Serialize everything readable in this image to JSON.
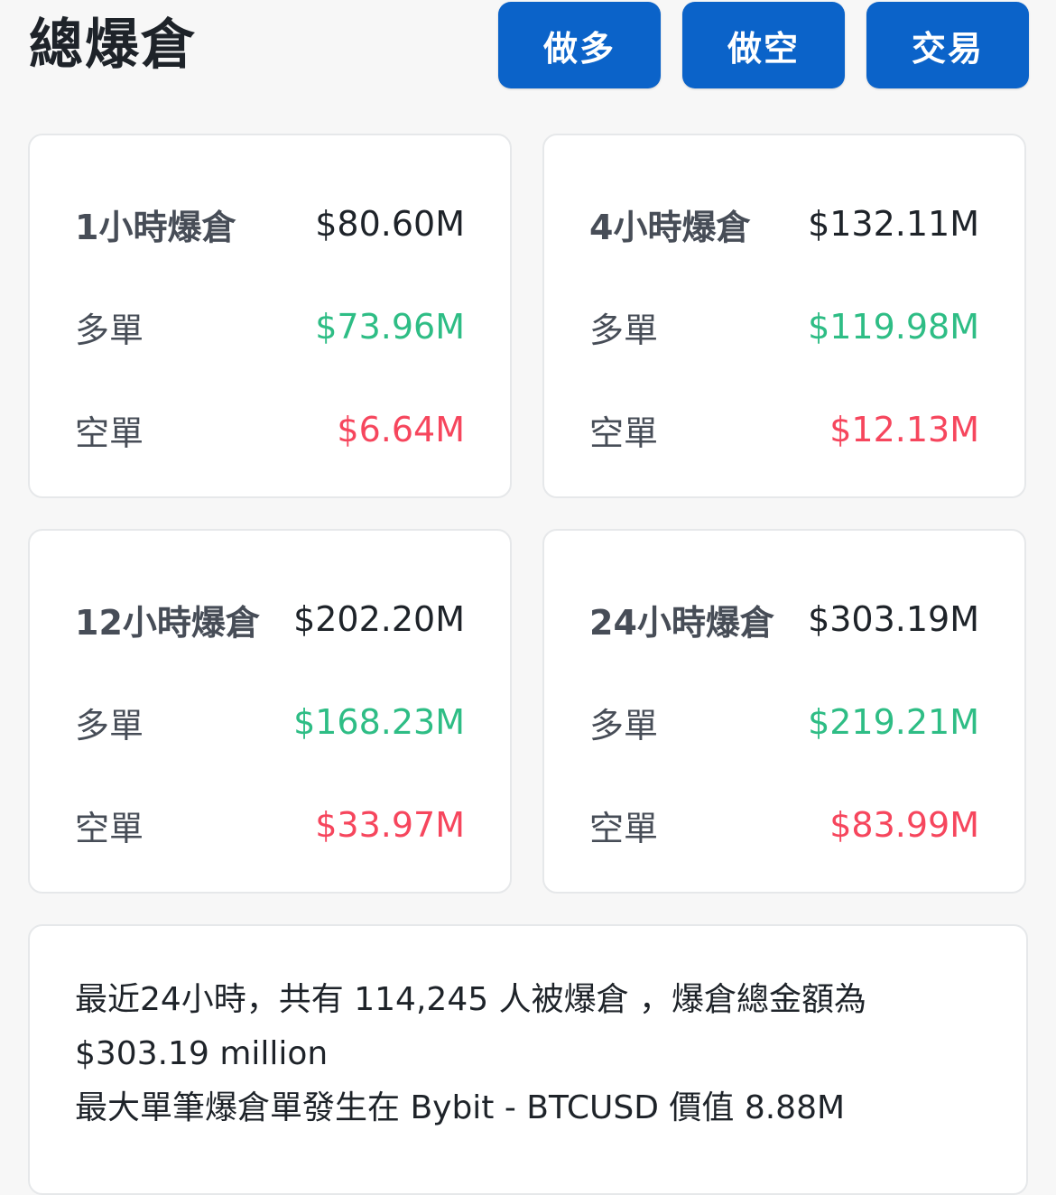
{
  "header": {
    "title": "總爆倉",
    "buttons": {
      "long": "做多",
      "short": "做空",
      "trade": "交易"
    }
  },
  "colors": {
    "button_bg": "#0b63c9",
    "long": "#2ebd85",
    "short": "#f6465d"
  },
  "cards": [
    {
      "label": "1小時爆倉",
      "total": "$80.60M",
      "long_label": "多單",
      "long": "$73.96M",
      "short_label": "空單",
      "short": "$6.64M"
    },
    {
      "label": "4小時爆倉",
      "total": "$132.11M",
      "long_label": "多單",
      "long": "$119.98M",
      "short_label": "空單",
      "short": "$12.13M"
    },
    {
      "label": "12小時爆倉",
      "total": "$202.20M",
      "long_label": "多單",
      "long": "$168.23M",
      "short_label": "空單",
      "short": "$33.97M"
    },
    {
      "label": "24小時爆倉",
      "total": "$303.19M",
      "long_label": "多單",
      "long": "$219.21M",
      "short_label": "空單",
      "short": "$83.99M"
    }
  ],
  "summary": {
    "line1": "最近24小時，共有 114,245 人被爆倉 ，爆倉總金額為",
    "line2": "$303.19 million",
    "line3": "最大單筆爆倉單發生在 Bybit - BTCUSD 價值 8.88M"
  }
}
